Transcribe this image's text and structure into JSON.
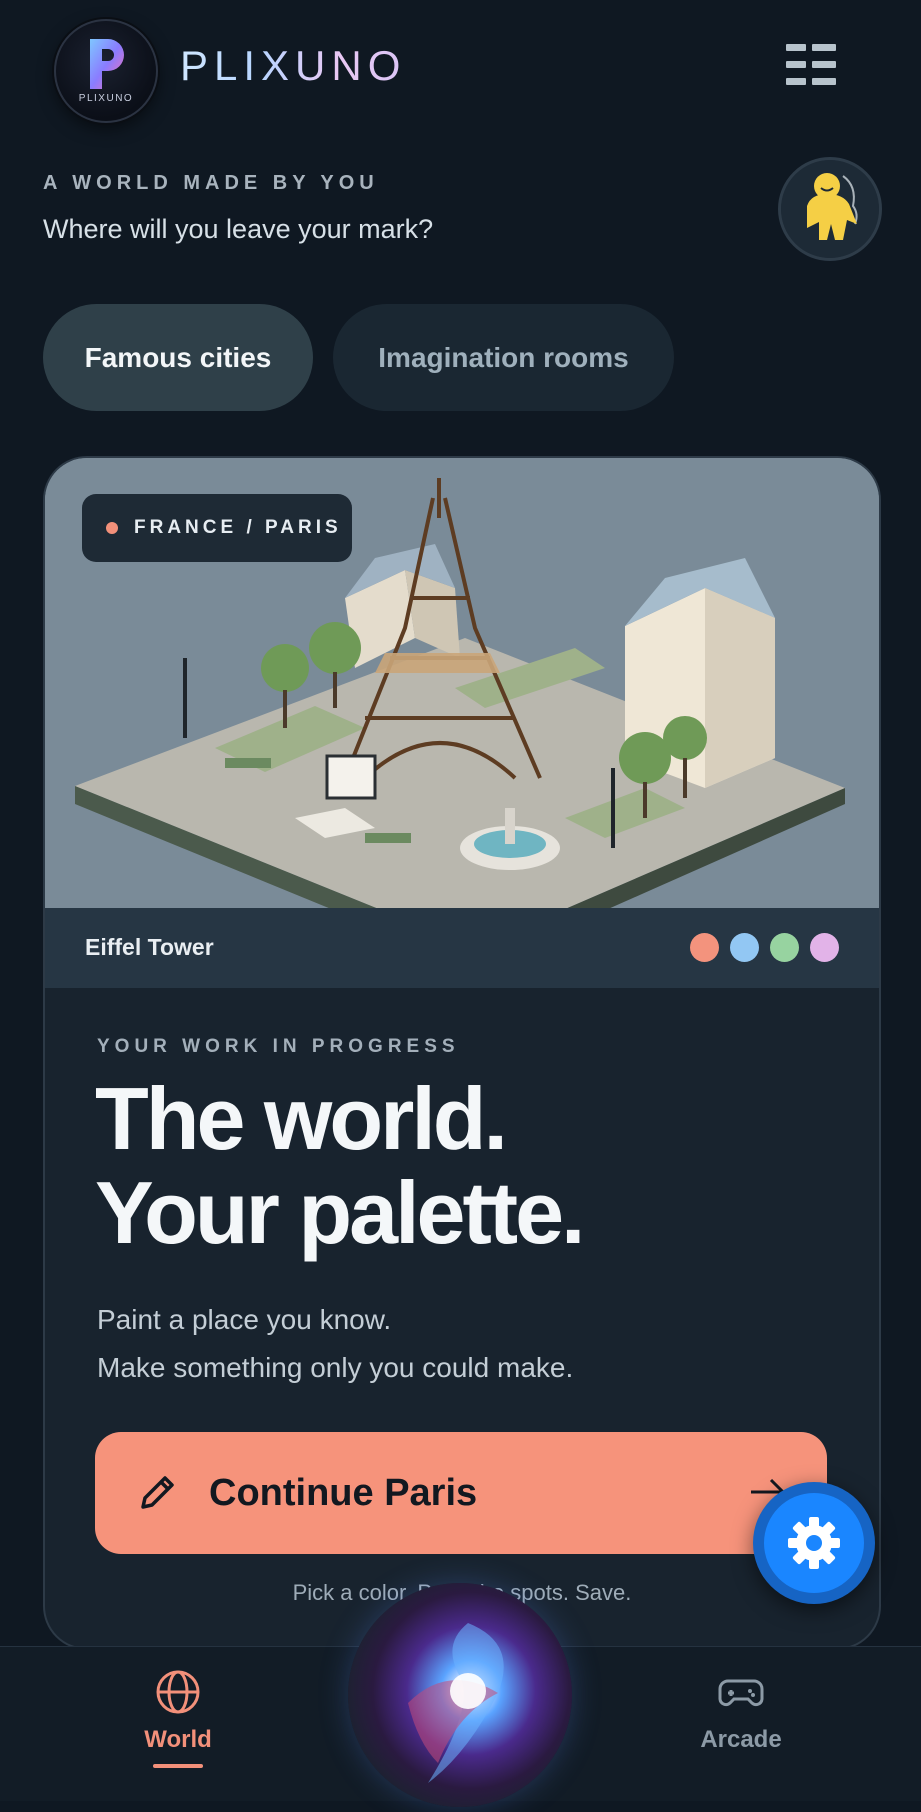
{
  "header": {
    "logo_small_text": "PLIXUNO",
    "brand": "PLIXUNO",
    "menu_icon": "menu-grid-icon"
  },
  "intro": {
    "eyebrow": "A WORLD MADE BY YOU",
    "tagline": "Where will you leave your mark?"
  },
  "tabs": [
    {
      "label": "Famous cities",
      "active": true
    },
    {
      "label": "Imagination rooms",
      "active": false
    }
  ],
  "card": {
    "location_pill": "FRANCE / PARIS",
    "caption": "Eiffel Tower",
    "palette": [
      "#f3937d",
      "#92c7f3",
      "#97d3a0",
      "#e2b3e8"
    ],
    "progress_eyebrow": "YOUR WORK IN PROGRESS",
    "headline": [
      "The world.",
      "Your palette."
    ],
    "description": [
      "Paint a place you know.",
      "Make something only you could make."
    ],
    "cta_label": "Continue Paris",
    "hint": "Pick a color. Paint the spots. Save."
  },
  "fab": {
    "icon": "gear-icon"
  },
  "nav": {
    "items": [
      {
        "label": "World",
        "icon": "globe-icon",
        "active": true
      },
      {
        "label": "Arcade",
        "icon": "gamepad-icon",
        "active": false
      }
    ]
  },
  "colors": {
    "background": "#0f1822",
    "accent": "#f6937b",
    "fab_blue": "#1a86ff"
  }
}
